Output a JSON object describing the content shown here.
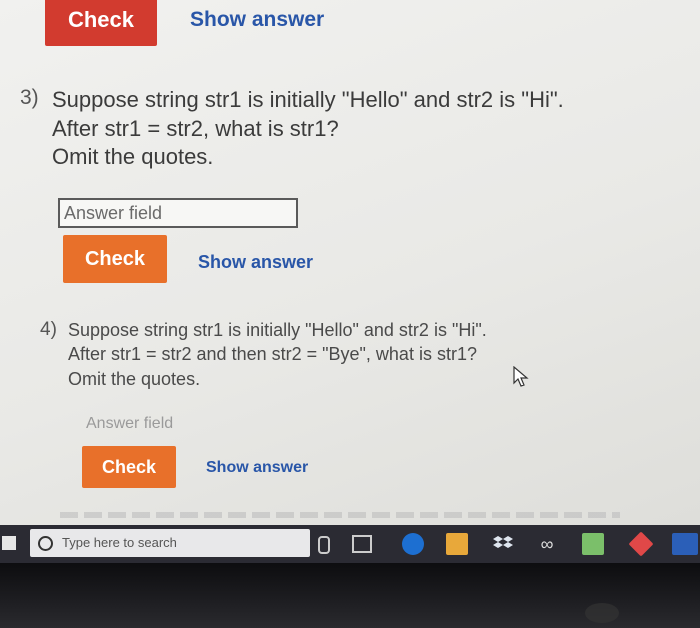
{
  "top": {
    "check_label": "Check",
    "show_answer_label": "Show answer"
  },
  "q3": {
    "number": "3)",
    "lines": [
      "Suppose string str1 is initially \"Hello\" and str2 is \"Hi\".",
      "After str1 = str2, what is str1?",
      "Omit the quotes."
    ],
    "placeholder": "Answer field",
    "check_label": "Check",
    "show_answer_label": "Show answer"
  },
  "q4": {
    "number": "4)",
    "lines": [
      "Suppose string str1 is initially \"Hello\" and str2 is \"Hi\".",
      "After str1 = str2 and then str2 = \"Bye\", what is str1?",
      "Omit the quotes."
    ],
    "placeholder": "Answer field",
    "check_label": "Check",
    "show_answer_label": "Show answer"
  },
  "taskbar": {
    "search_placeholder": "Type here to search"
  },
  "colors": {
    "check_red": "#d23b2f",
    "check_orange": "#e8702a",
    "link_blue": "#2956a8"
  }
}
